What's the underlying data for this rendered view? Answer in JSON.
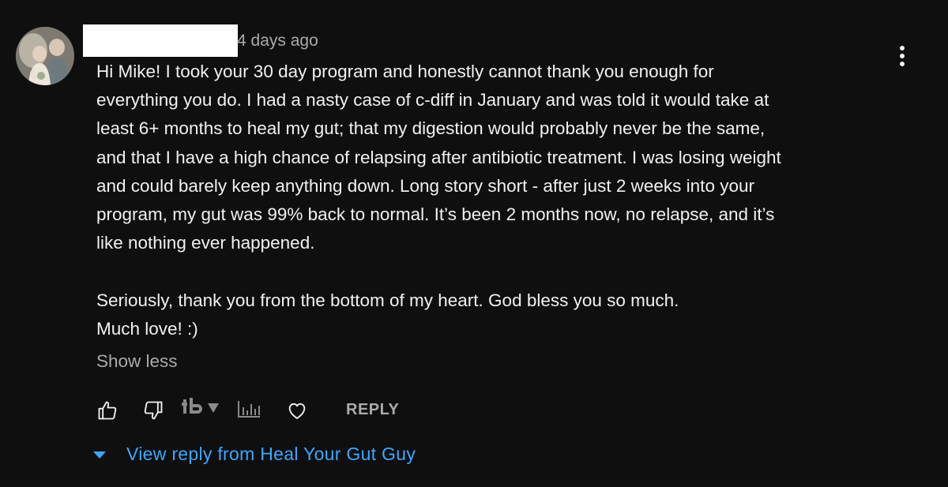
{
  "comment": {
    "timestamp": "4 days ago",
    "paragraphs": [
      "Hi Mike! I took your 30 day program and honestly cannot thank you enough for",
      "everything you do. I had a nasty case of c-diff in January and was told it would take at",
      "least 6+ months to heal my gut; that my digestion would probably never be the same,",
      "and that I have a high chance of relapsing after antibiotic treatment. I was losing weight",
      "and could barely keep anything down. Long story short - after just 2 weeks into your",
      "program, my gut was 99% back to normal. It’s been 2 months now, no relapse, and it’s",
      "like nothing ever happened."
    ],
    "closing": [
      "Seriously, thank you from the bottom of my heart. God bless you so much.",
      "Much love! :)"
    ],
    "show_less_label": "Show less"
  },
  "actions": {
    "reply_label": "REPLY",
    "icons": [
      "thumbs-up-icon",
      "thumbs-down-icon",
      "tubebuddy-icon",
      "dropdown-arrow-icon",
      "bar-chart-icon",
      "heart-icon"
    ]
  },
  "replies": {
    "view_reply_label": "View reply from Heal Your Gut Guy"
  },
  "colors": {
    "background": "#0f0f0f",
    "text": "#f1f1f1",
    "muted": "#aaaaaa",
    "link": "#3ea6ff"
  }
}
